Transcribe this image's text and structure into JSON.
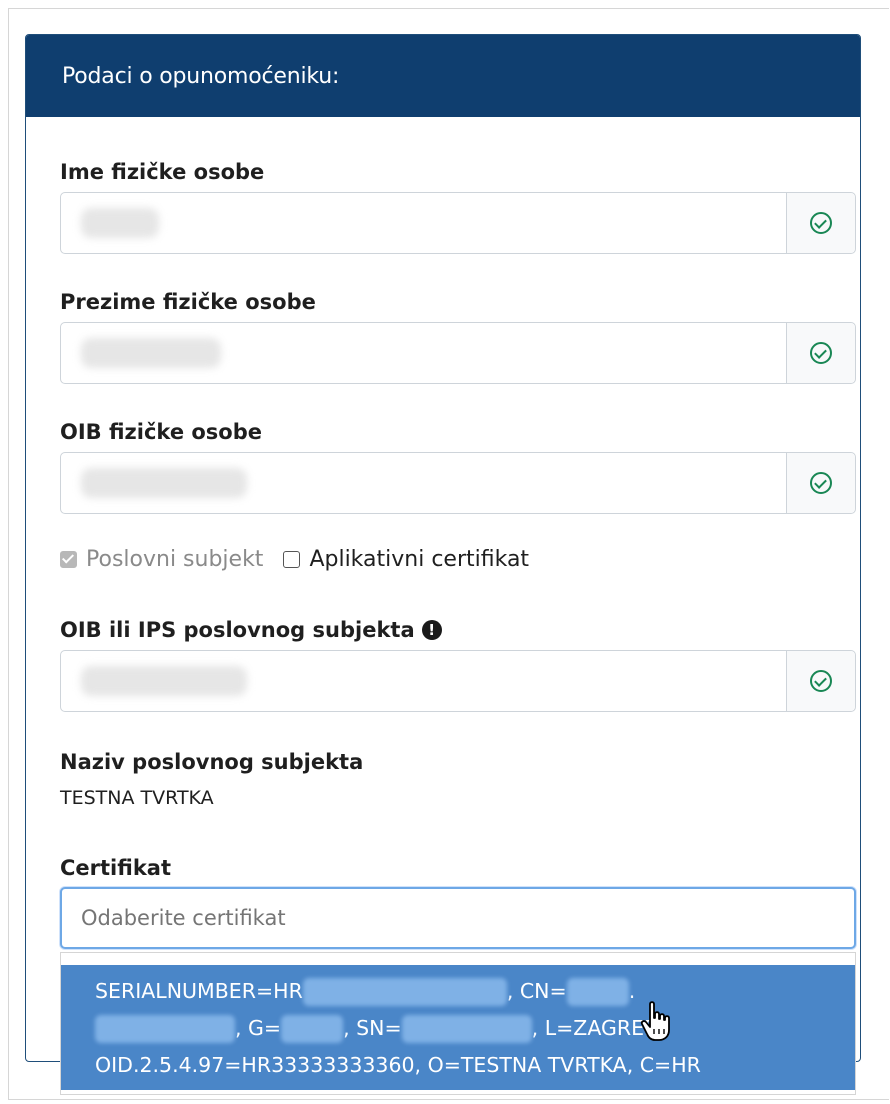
{
  "card": {
    "title": "Podaci o opunomoćeniku:"
  },
  "fields": {
    "first_name": {
      "label": "Ime fizičke osobe",
      "value": ""
    },
    "last_name": {
      "label": "Prezime fizičke osobe",
      "value": ""
    },
    "oib": {
      "label": "OIB fizičke osobe",
      "value": ""
    },
    "business_oib": {
      "label": "OIB ili IPS poslovnog subjekta",
      "value": ""
    }
  },
  "checkboxes": {
    "business_subject": {
      "label": "Poslovni subjekt",
      "checked": true,
      "disabled": true
    },
    "app_certificate": {
      "label": "Aplikativni certifikat",
      "checked": false
    }
  },
  "business_name": {
    "label": "Naziv poslovnog subjekta",
    "value": "TESTNA TVRTKA"
  },
  "certificate": {
    "label": "Certifikat",
    "placeholder": "Odaberite certifikat",
    "option": {
      "line1_part1": "SERIALNUMBER=HR",
      "line1_part2": ", CN=",
      "line1_part3": ".",
      "line2_part1": ", G=",
      "line2_part2": ", SN=",
      "line2_part3": ", L=ZAGREB,",
      "line3": "OID.2.5.4.97=HR33333333360, O=TESTNA TVRTKA, C=HR"
    }
  },
  "colors": {
    "header_bg": "#0f3e6f",
    "valid_green": "#198754",
    "option_highlight": "#4a86c8",
    "focus_border": "#6ea8e6"
  },
  "icons": {
    "valid": "check-circle-icon",
    "info": "exclamation-circle-icon",
    "cursor": "hand-pointer-icon"
  }
}
